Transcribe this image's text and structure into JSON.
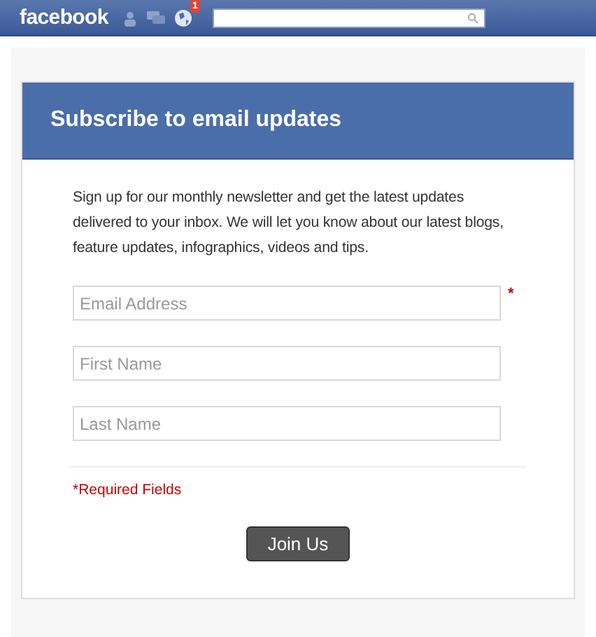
{
  "top_bar": {
    "logo": "facebook",
    "notification_count": "1"
  },
  "form": {
    "title": "Subscribe to email updates",
    "intro": "Sign up for our monthly newsletter and get the latest updates delivered to your inbox. We will let you know about our latest blogs, feature updates, infographics, videos and tips.",
    "fields": [
      {
        "placeholder": "Email Address",
        "required_mark": "*"
      },
      {
        "placeholder": "First Name"
      },
      {
        "placeholder": "Last Name"
      }
    ],
    "required_note": "*Required Fields",
    "submit": "Join Us"
  }
}
